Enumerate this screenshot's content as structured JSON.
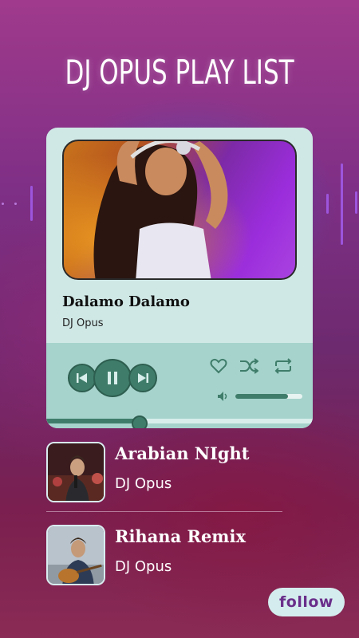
{
  "header": {
    "title": "DJ OPUS PLAY LIST"
  },
  "now_playing": {
    "title": "Dalamo Dalamo",
    "artist": "DJ Opus",
    "volume_level": 0.78,
    "progress": 0.35
  },
  "playlist": [
    {
      "title": "Arabian NIght",
      "artist": "DJ Opus"
    },
    {
      "title": "Rihana Remix",
      "artist": "DJ Opus"
    }
  ],
  "follow_button": {
    "label": "follow"
  },
  "colors": {
    "accent": "#3f7d6a",
    "card": "#cfe8e6",
    "card_bottom": "#a6d3cc",
    "follow_text": "#6a2f8a"
  },
  "icons": [
    "previous-icon",
    "pause-icon",
    "next-icon",
    "heart-icon",
    "shuffle-icon",
    "repeat-icon",
    "volume-icon"
  ]
}
